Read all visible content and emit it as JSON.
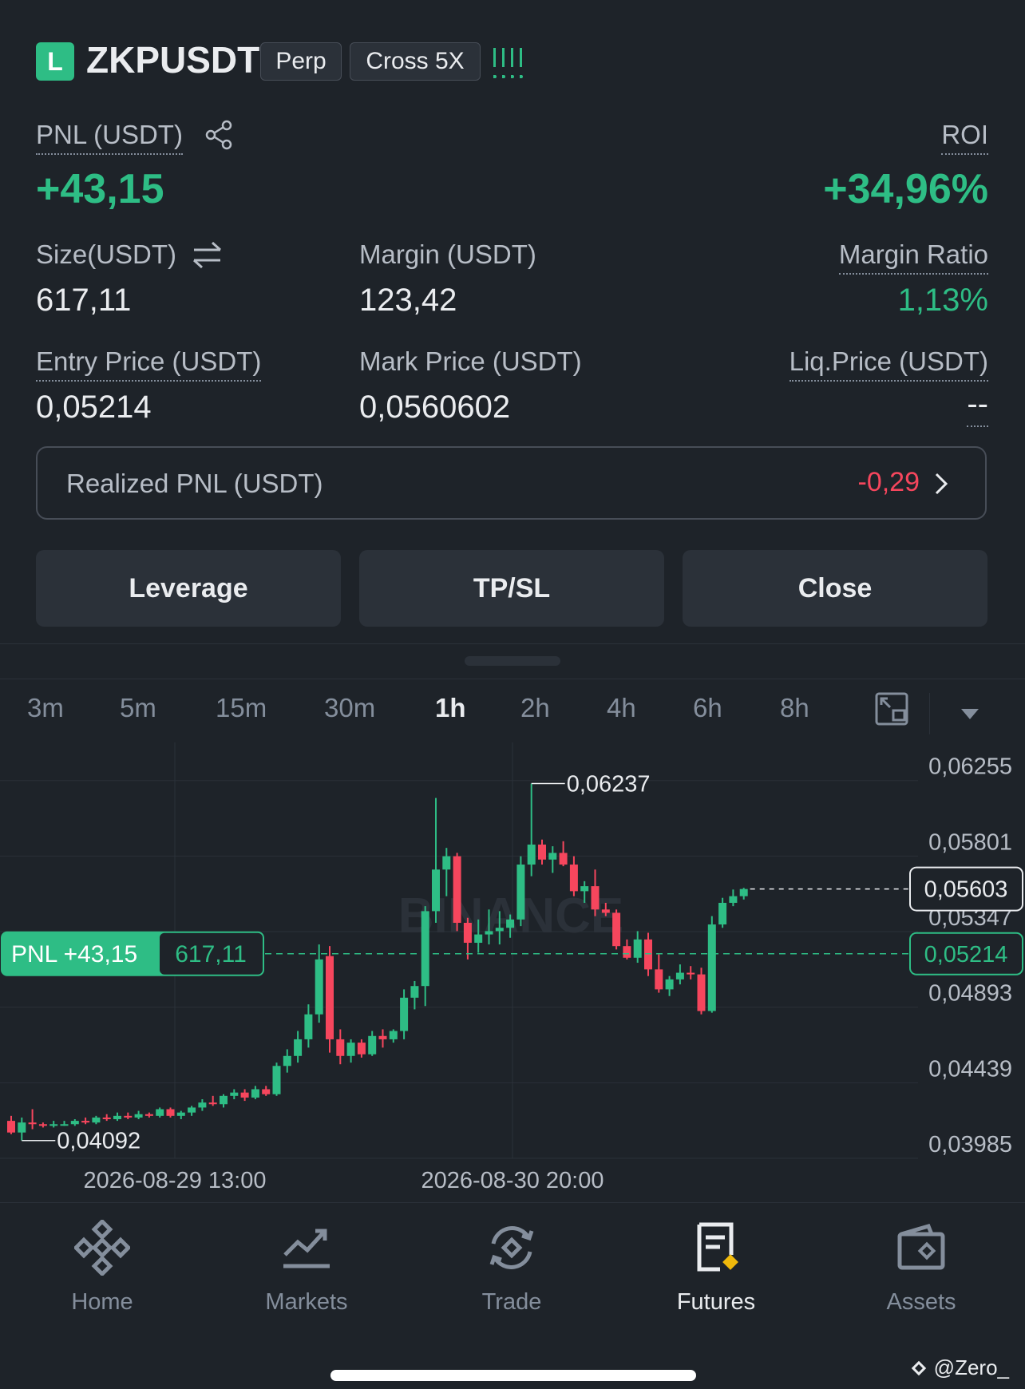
{
  "header": {
    "side_badge": "L",
    "symbol": "ZKPUSDT",
    "type_tag": "Perp",
    "margin_tag": "Cross 5X"
  },
  "position": {
    "pnl_label": "PNL (USDT)",
    "pnl_value": "+43,15",
    "roi_label": "ROI",
    "roi_value": "+34,96%",
    "size_label": "Size(USDT)",
    "size_value": "617,11",
    "margin_label": "Margin (USDT)",
    "margin_value": "123,42",
    "margin_ratio_label": "Margin Ratio",
    "margin_ratio_value": "1,13%",
    "entry_label": "Entry Price (USDT)",
    "entry_value": "0,05214",
    "mark_label": "Mark Price (USDT)",
    "mark_value": "0,0560602",
    "liq_label": "Liq.Price (USDT)",
    "liq_value": "--",
    "realized_label": "Realized PNL (USDT)",
    "realized_value": "-0,29"
  },
  "actions": {
    "leverage": "Leverage",
    "tpsl": "TP/SL",
    "close": "Close"
  },
  "timeframes": [
    "3m",
    "5m",
    "15m",
    "30m",
    "1h",
    "2h",
    "4h",
    "6h",
    "8h"
  ],
  "active_timeframe": "1h",
  "chart": {
    "watermark": "BINANCE",
    "high_label": "0,06237",
    "low_label": "0,04092",
    "pnl_tag_label": "PNL +43,15",
    "pnl_tag_size": "617,11",
    "mark_tag": "0,05603",
    "entry_tag": "0,05214",
    "y_ticks": [
      "0,06255",
      "0,05801",
      "0,05347",
      "0,04893",
      "0,04439",
      "0,03985"
    ],
    "x_ticks": [
      "2026-08-29 13:00",
      "2026-08-30 20:00"
    ],
    "colors": {
      "up": "#2ebd85",
      "down": "#f6465d"
    }
  },
  "chart_data": {
    "type": "candlestick",
    "interval": "1h",
    "ylim": [
      0.03985,
      0.06484
    ],
    "y_ticks": [
      0.06255,
      0.05801,
      0.05347,
      0.04893,
      0.04439,
      0.03985
    ],
    "x_ticks": [
      "2026-08-29 13:00",
      "2026-08-30 20:00"
    ],
    "high_marker": 0.06237,
    "low_marker": 0.04092,
    "entry_price": 0.05214,
    "mark_price": 0.05603,
    "candles": [
      {
        "o": 0.0421,
        "h": 0.0424,
        "l": 0.0413,
        "c": 0.0414
      },
      {
        "o": 0.0414,
        "h": 0.0423,
        "l": 0.04092,
        "c": 0.042
      },
      {
        "o": 0.042,
        "h": 0.0428,
        "l": 0.0416,
        "c": 0.0419
      },
      {
        "o": 0.0419,
        "h": 0.042,
        "l": 0.0417,
        "c": 0.0418
      },
      {
        "o": 0.0418,
        "h": 0.0421,
        "l": 0.0417,
        "c": 0.0419
      },
      {
        "o": 0.0419,
        "h": 0.0421,
        "l": 0.0418,
        "c": 0.0419
      },
      {
        "o": 0.0419,
        "h": 0.0422,
        "l": 0.0418,
        "c": 0.0421
      },
      {
        "o": 0.0421,
        "h": 0.0423,
        "l": 0.0419,
        "c": 0.042
      },
      {
        "o": 0.042,
        "h": 0.0424,
        "l": 0.0419,
        "c": 0.0423
      },
      {
        "o": 0.0423,
        "h": 0.0425,
        "l": 0.0421,
        "c": 0.0422
      },
      {
        "o": 0.0422,
        "h": 0.0426,
        "l": 0.0421,
        "c": 0.0424
      },
      {
        "o": 0.0424,
        "h": 0.0426,
        "l": 0.0422,
        "c": 0.0423
      },
      {
        "o": 0.0423,
        "h": 0.0427,
        "l": 0.0422,
        "c": 0.0425
      },
      {
        "o": 0.0425,
        "h": 0.0426,
        "l": 0.0423,
        "c": 0.0424
      },
      {
        "o": 0.0424,
        "h": 0.0429,
        "l": 0.0423,
        "c": 0.0428
      },
      {
        "o": 0.0428,
        "h": 0.0429,
        "l": 0.0423,
        "c": 0.0424
      },
      {
        "o": 0.0424,
        "h": 0.0427,
        "l": 0.0422,
        "c": 0.0426
      },
      {
        "o": 0.0426,
        "h": 0.043,
        "l": 0.0424,
        "c": 0.0429
      },
      {
        "o": 0.0429,
        "h": 0.0434,
        "l": 0.0427,
        "c": 0.0432
      },
      {
        "o": 0.0432,
        "h": 0.0436,
        "l": 0.043,
        "c": 0.0431
      },
      {
        "o": 0.0431,
        "h": 0.0437,
        "l": 0.0429,
        "c": 0.0436
      },
      {
        "o": 0.0436,
        "h": 0.044,
        "l": 0.0434,
        "c": 0.0438
      },
      {
        "o": 0.0438,
        "h": 0.044,
        "l": 0.0433,
        "c": 0.0435
      },
      {
        "o": 0.0435,
        "h": 0.0442,
        "l": 0.0434,
        "c": 0.044
      },
      {
        "o": 0.044,
        "h": 0.0442,
        "l": 0.0436,
        "c": 0.0437
      },
      {
        "o": 0.0437,
        "h": 0.0456,
        "l": 0.0436,
        "c": 0.0454
      },
      {
        "o": 0.0454,
        "h": 0.0464,
        "l": 0.045,
        "c": 0.046
      },
      {
        "o": 0.046,
        "h": 0.0475,
        "l": 0.0456,
        "c": 0.047
      },
      {
        "o": 0.047,
        "h": 0.0491,
        "l": 0.0465,
        "c": 0.0485
      },
      {
        "o": 0.0485,
        "h": 0.0527,
        "l": 0.048,
        "c": 0.0518
      },
      {
        "o": 0.052,
        "h": 0.0526,
        "l": 0.0462,
        "c": 0.047
      },
      {
        "o": 0.047,
        "h": 0.0476,
        "l": 0.0455,
        "c": 0.046
      },
      {
        "o": 0.046,
        "h": 0.047,
        "l": 0.0456,
        "c": 0.0468
      },
      {
        "o": 0.0468,
        "h": 0.047,
        "l": 0.0459,
        "c": 0.0461
      },
      {
        "o": 0.0461,
        "h": 0.0475,
        "l": 0.046,
        "c": 0.0472
      },
      {
        "o": 0.0472,
        "h": 0.0476,
        "l": 0.0465,
        "c": 0.047
      },
      {
        "o": 0.047,
        "h": 0.0476,
        "l": 0.0468,
        "c": 0.0475
      },
      {
        "o": 0.0475,
        "h": 0.05,
        "l": 0.047,
        "c": 0.0495
      },
      {
        "o": 0.0495,
        "h": 0.0505,
        "l": 0.0488,
        "c": 0.0502
      },
      {
        "o": 0.0502,
        "h": 0.055,
        "l": 0.049,
        "c": 0.0547
      },
      {
        "o": 0.0547,
        "h": 0.0615,
        "l": 0.054,
        "c": 0.0572
      },
      {
        "o": 0.0572,
        "h": 0.0585,
        "l": 0.0556,
        "c": 0.058
      },
      {
        "o": 0.058,
        "h": 0.0582,
        "l": 0.0535,
        "c": 0.054
      },
      {
        "o": 0.054,
        "h": 0.0543,
        "l": 0.0518,
        "c": 0.0528
      },
      {
        "o": 0.0528,
        "h": 0.0542,
        "l": 0.0522,
        "c": 0.0533
      },
      {
        "o": 0.0533,
        "h": 0.0548,
        "l": 0.0527,
        "c": 0.0535
      },
      {
        "o": 0.0535,
        "h": 0.0547,
        "l": 0.0527,
        "c": 0.0537
      },
      {
        "o": 0.0537,
        "h": 0.0545,
        "l": 0.0531,
        "c": 0.0542
      },
      {
        "o": 0.0542,
        "h": 0.058,
        "l": 0.0538,
        "c": 0.0575
      },
      {
        "o": 0.0575,
        "h": 0.06237,
        "l": 0.0568,
        "c": 0.0587
      },
      {
        "o": 0.0587,
        "h": 0.059,
        "l": 0.0575,
        "c": 0.0578
      },
      {
        "o": 0.0578,
        "h": 0.0586,
        "l": 0.057,
        "c": 0.0582
      },
      {
        "o": 0.0582,
        "h": 0.0589,
        "l": 0.0574,
        "c": 0.0575
      },
      {
        "o": 0.0575,
        "h": 0.058,
        "l": 0.0556,
        "c": 0.0559
      },
      {
        "o": 0.0559,
        "h": 0.0565,
        "l": 0.0552,
        "c": 0.0562
      },
      {
        "o": 0.0562,
        "h": 0.0572,
        "l": 0.0544,
        "c": 0.0548
      },
      {
        "o": 0.0548,
        "h": 0.0552,
        "l": 0.0544,
        "c": 0.0546
      },
      {
        "o": 0.0546,
        "h": 0.0548,
        "l": 0.0524,
        "c": 0.0526
      },
      {
        "o": 0.0526,
        "h": 0.053,
        "l": 0.0518,
        "c": 0.0519
      },
      {
        "o": 0.0519,
        "h": 0.0535,
        "l": 0.0516,
        "c": 0.053
      },
      {
        "o": 0.053,
        "h": 0.0534,
        "l": 0.0508,
        "c": 0.0512
      },
      {
        "o": 0.0512,
        "h": 0.0521,
        "l": 0.0498,
        "c": 0.05
      },
      {
        "o": 0.05,
        "h": 0.0508,
        "l": 0.0496,
        "c": 0.0506
      },
      {
        "o": 0.0506,
        "h": 0.0515,
        "l": 0.0503,
        "c": 0.051
      },
      {
        "o": 0.051,
        "h": 0.0514,
        "l": 0.0506,
        "c": 0.0509
      },
      {
        "o": 0.0509,
        "h": 0.0513,
        "l": 0.0485,
        "c": 0.0487
      },
      {
        "o": 0.0487,
        "h": 0.0544,
        "l": 0.0486,
        "c": 0.0539
      },
      {
        "o": 0.0539,
        "h": 0.0555,
        "l": 0.0537,
        "c": 0.0552
      },
      {
        "o": 0.0552,
        "h": 0.056,
        "l": 0.055,
        "c": 0.0556
      },
      {
        "o": 0.0556,
        "h": 0.0561,
        "l": 0.0554,
        "c": 0.05603
      }
    ]
  },
  "nav": {
    "items": [
      {
        "label": "Home",
        "icon": "home-icon"
      },
      {
        "label": "Markets",
        "icon": "markets-icon"
      },
      {
        "label": "Trade",
        "icon": "trade-icon"
      },
      {
        "label": "Futures",
        "icon": "futures-icon"
      },
      {
        "label": "Assets",
        "icon": "assets-icon"
      }
    ],
    "active": "Futures"
  },
  "footer": {
    "watermark": "@Zero_"
  }
}
